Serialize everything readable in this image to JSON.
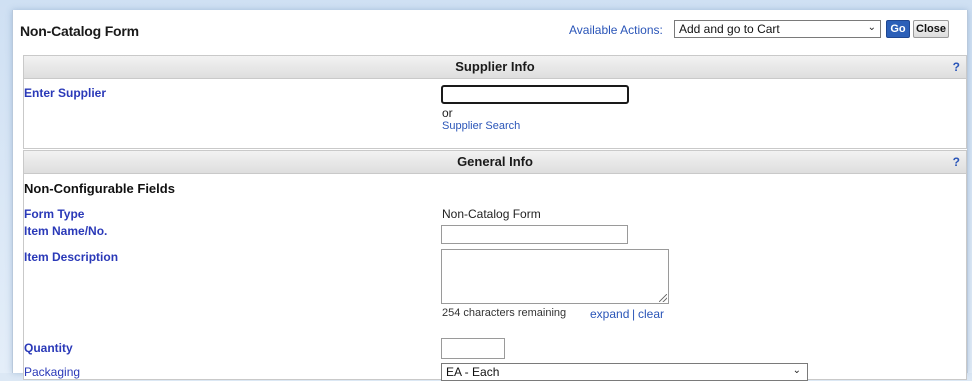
{
  "header": {
    "title": "Non-Catalog Form",
    "actions_label": "Available Actions:",
    "actions_selected": "Add and go to Cart",
    "go_label": "Go",
    "close_label": "Close"
  },
  "supplier_section": {
    "title": "Supplier Info",
    "help": "?",
    "enter_supplier_label": "Enter Supplier",
    "supplier_value": "",
    "or_text": "or",
    "supplier_search_link": "Supplier Search"
  },
  "general_section": {
    "title": "General Info",
    "help": "?",
    "subheading": "Non-Configurable Fields",
    "form_type_label": "Form Type",
    "form_type_value": "Non-Catalog Form",
    "item_name_label": "Item Name/No.",
    "item_name_value": "",
    "item_description_label": "Item Description",
    "item_description_value": "",
    "chars_remaining": "254 characters remaining",
    "expand_link": "expand",
    "separator": "|",
    "clear_link": "clear",
    "quantity_label": "Quantity",
    "quantity_value": "",
    "packaging_label": "Packaging",
    "packaging_selected": "EA - Each"
  },
  "icons": {
    "dropdown": "chevron-down-icon",
    "help": "help-icon"
  }
}
